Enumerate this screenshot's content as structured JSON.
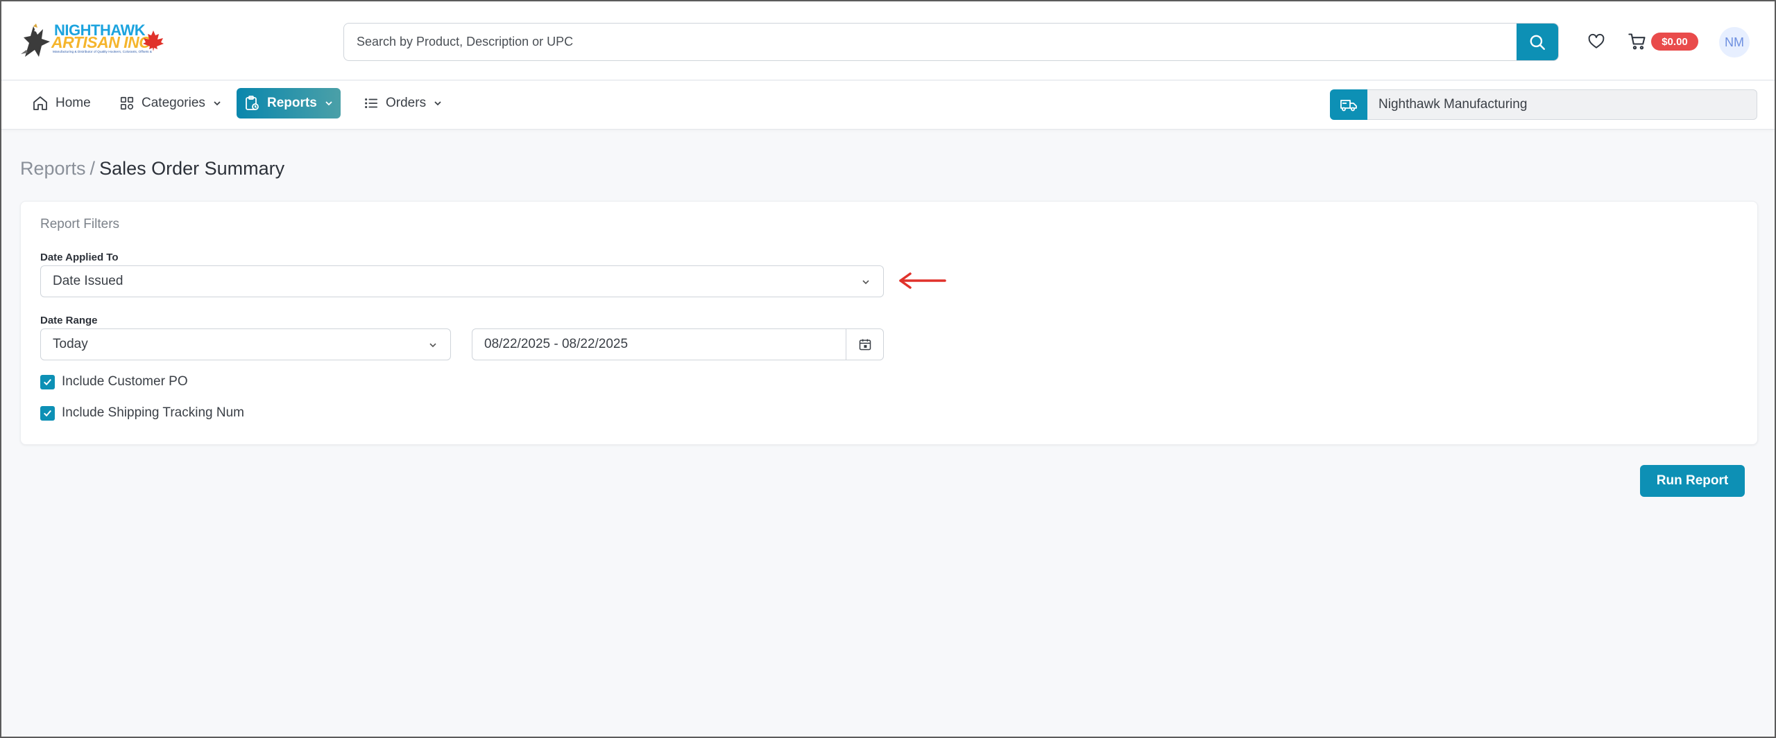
{
  "brand": {
    "name_line1": "NIGHTHAWK",
    "name_line2": "ARTISAN INC.",
    "tagline": "Manufacturing & Distributor of Quality Hookers, Colorants, Offsets & Dyes, Stocking Accessories",
    "colors": {
      "primary": "#0d90b5",
      "badge": "#e94b4b",
      "logo_blue": "#1ca3de",
      "logo_gold": "#f5b52c",
      "leaf": "#e0322b"
    }
  },
  "header": {
    "search_placeholder": "Search by Product, Description or UPC",
    "search_icon": "search-icon",
    "wishlist_icon": "heart-icon",
    "cart_icon": "cart-icon",
    "cart_total": "$0.00",
    "avatar_initials": "NM"
  },
  "nav": {
    "items": [
      {
        "label": "Home",
        "icon": "home-icon"
      },
      {
        "label": "Categories",
        "icon": "grid-icon"
      },
      {
        "label": "Reports",
        "icon": "clipboard-icon",
        "active": true
      },
      {
        "label": "Orders",
        "icon": "list-icon"
      }
    ],
    "vendor_icon": "truck-icon",
    "vendor_name": "Nighthawk Manufacturing"
  },
  "breadcrumb": {
    "root": "Reports",
    "separator": "/",
    "current": "Sales Order Summary"
  },
  "filters": {
    "card_title": "Report Filters",
    "date_applied_label": "Date Applied To",
    "date_applied_value": "Date Issued",
    "date_range_label": "Date Range",
    "date_range_value": "Today",
    "date_range_text": "08/22/2025 - 08/22/2025",
    "include_customer_po": {
      "label": "Include Customer PO",
      "checked": true
    },
    "include_tracking": {
      "label": "Include Shipping Tracking Num",
      "checked": true
    }
  },
  "actions": {
    "run_report": "Run Report"
  }
}
